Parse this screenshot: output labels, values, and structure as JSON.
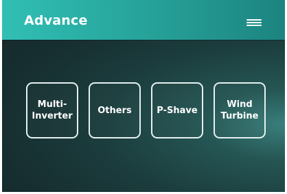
{
  "header": {
    "title": "Advance",
    "menu_icon": "hamburger-menu-icon"
  },
  "options": [
    {
      "label": "Multi-\nInverter"
    },
    {
      "label": "Others"
    },
    {
      "label": "P-Shave"
    },
    {
      "label": "Wind\nTurbine"
    }
  ],
  "colors": {
    "header_gradient_start": "#31bfb4",
    "header_gradient_end": "#1d8480",
    "background_dark": "#142728",
    "text": "#ffffff",
    "button_border": "#e6f2f1"
  }
}
